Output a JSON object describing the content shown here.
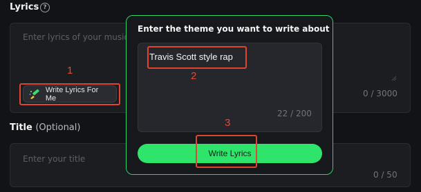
{
  "lyrics_section": {
    "title": "Lyrics",
    "help_icon": "question-circle-icon",
    "placeholder": "Enter lyrics of your music",
    "counter": "0 / 3000",
    "write_button_label": "Write Lyrics For Me",
    "write_button_icon": "magic-pen-icon"
  },
  "title_section": {
    "title": "Title",
    "optional": "(Optional)",
    "placeholder": "Enter your title",
    "counter": "0 / 50"
  },
  "popup": {
    "title": "Enter the theme you want to write about",
    "theme_value": "Travis Scott style rap",
    "counter": "22 / 200",
    "button_label": "Write Lyrics"
  },
  "annotations": {
    "one": "1",
    "two": "2",
    "three": "3"
  },
  "colors": {
    "accent_green": "#2ee46b",
    "annotation_red": "#e2452f",
    "background": "#121316"
  }
}
